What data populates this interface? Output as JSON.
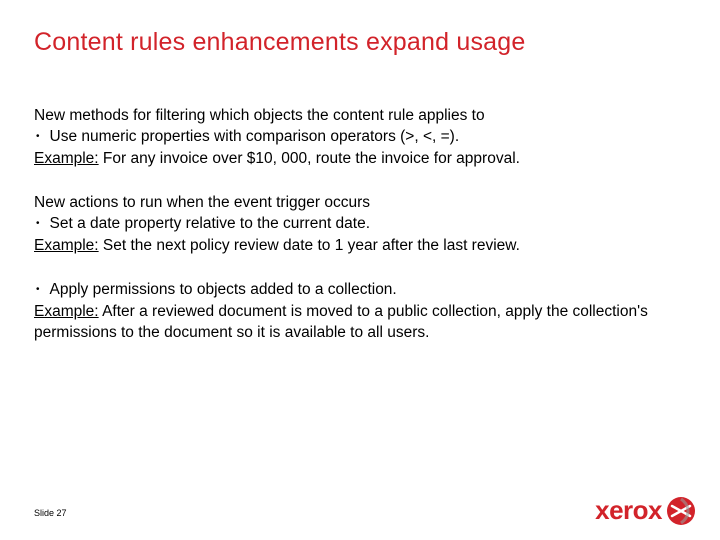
{
  "title": "Content rules enhancements expand usage",
  "section1": {
    "heading": "New methods for filtering which objects the content rule applies to",
    "bullet": "Use numeric properties with comparison operators (>, <, =).",
    "example_label": "Example:",
    "example_text": " For any invoice over $10, 000, route the invoice for approval."
  },
  "section2": {
    "heading": "New actions to run when the event trigger occurs",
    "bullet": "Set a date property relative to the current date.",
    "example_label": "Example:",
    "example_text": " Set the next policy review date to 1 year after the last review."
  },
  "section3": {
    "bullet": "Apply permissions to objects added to a collection.",
    "example_label": "Example:",
    "example_text": " After a reviewed document is moved to a public collection, apply the collection's permissions to the document so it is available to all users."
  },
  "footer": "Slide 27",
  "logo_text": "xerox"
}
